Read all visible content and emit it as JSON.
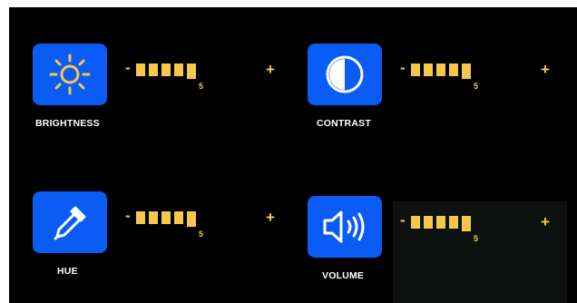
{
  "settings": [
    {
      "label": "BRIGHTNESS",
      "icon": "sun-icon",
      "level": "5",
      "minus": "-",
      "plus": "+",
      "level_fraction": 1.0
    },
    {
      "label": "CONTRAST",
      "icon": "contrast-icon",
      "level": "5",
      "minus": "-",
      "plus": "+",
      "level_fraction": 1.0
    },
    {
      "label": "HUE",
      "icon": "eyedropper-icon",
      "level": "5",
      "minus": "-",
      "plus": "+",
      "level_fraction": 1.0
    },
    {
      "label": "VOLUME",
      "icon": "speaker-icon",
      "level": "5",
      "minus": "-",
      "plus": "+",
      "level_fraction": 1.0
    }
  ],
  "colors": {
    "background": "#000000",
    "tile": "#0a5cf5",
    "accent": "#f5c84c",
    "sun": "#f5c84c",
    "label": "#ffffff"
  }
}
